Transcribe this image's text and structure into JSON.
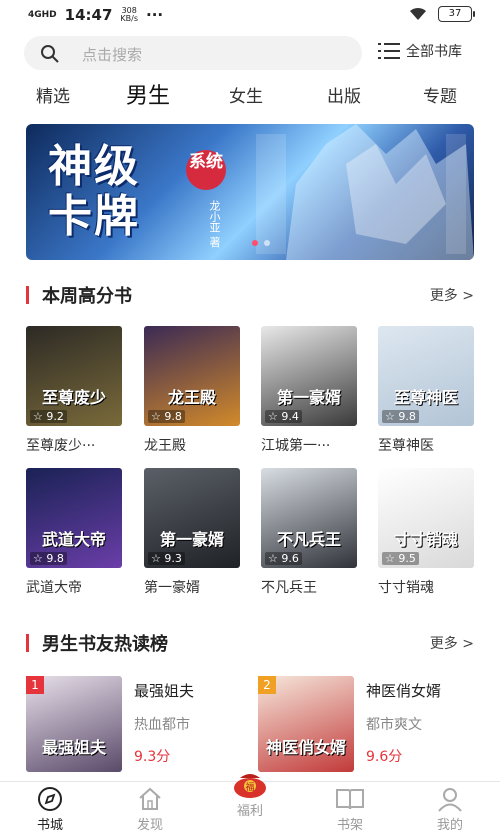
{
  "status": {
    "time": "14:47",
    "network": "4GHD",
    "speed_value": "308",
    "speed_unit": "KB/s",
    "menu": "···",
    "battery": "37"
  },
  "search": {
    "placeholder": "点击搜索",
    "all_books": "全部书库"
  },
  "tabs": [
    "精选",
    "男生",
    "女生",
    "出版",
    "专题"
  ],
  "active_tab": "男生",
  "banner": {
    "title_line1": "神级",
    "title_line2": "卡牌",
    "tag": "系统",
    "author": "龙小亚 著"
  },
  "section1": {
    "title": "本周高分书",
    "more": "更多"
  },
  "books": [
    {
      "cover_title": "至尊废少",
      "score": "9.2",
      "name": "至尊废少···",
      "c1": "#2c2a25",
      "c2": "#7a6a3a"
    },
    {
      "cover_title": "龙王殿",
      "score": "9.8",
      "name": "龙王殿",
      "c1": "#3b2a55",
      "c2": "#d28a2a"
    },
    {
      "cover_title": "第一豪婿",
      "score": "9.4",
      "name": "江城第一···",
      "c1": "#e8e8e8",
      "c2": "#3a3a3a"
    },
    {
      "cover_title": "至尊神医",
      "score": "9.8",
      "name": "至尊神医",
      "c1": "#dde7f0",
      "c2": "#b2c4d6"
    },
    {
      "cover_title": "武道大帝",
      "score": "9.8",
      "name": "武道大帝",
      "c1": "#1a2255",
      "c2": "#6a3ea8"
    },
    {
      "cover_title": "第一豪婿",
      "score": "9.3",
      "name": "第一豪婿",
      "c1": "#5b6068",
      "c2": "#1f2226"
    },
    {
      "cover_title": "不凡兵王",
      "score": "9.6",
      "name": "不凡兵王",
      "c1": "#d8dde3",
      "c2": "#30343a"
    },
    {
      "cover_title": "寸寸销魂",
      "score": "9.5",
      "name": "寸寸销魂",
      "c1": "#ffffff",
      "c2": "#d9d9d9"
    }
  ],
  "section2": {
    "title": "男生书友热读榜",
    "more": "更多"
  },
  "ranking": [
    {
      "rank": "1",
      "rank_color": "#e5343c",
      "cover_title": "最强姐夫",
      "name": "最强姐夫",
      "category": "热血都市",
      "score": "9.3分",
      "c1": "#e8e0ea",
      "c2": "#5a4a6a"
    },
    {
      "rank": "2",
      "rank_color": "#f0a023",
      "cover_title": "神医俏女婿",
      "name": "神医俏女婿",
      "category": "都市爽文",
      "score": "9.6分",
      "c1": "#f6e8dc",
      "c2": "#c23a3a"
    }
  ],
  "nav": [
    {
      "label": "书城",
      "icon": "compass-icon",
      "active": true
    },
    {
      "label": "发现",
      "icon": "home-icon",
      "active": false
    },
    {
      "label": "福利",
      "icon": "gift-bag-icon",
      "active": false
    },
    {
      "label": "书架",
      "icon": "book-icon",
      "active": false
    },
    {
      "label": "我的",
      "icon": "user-icon",
      "active": false
    }
  ],
  "welfare_badge": "福",
  "accent_color": "#e5343c"
}
